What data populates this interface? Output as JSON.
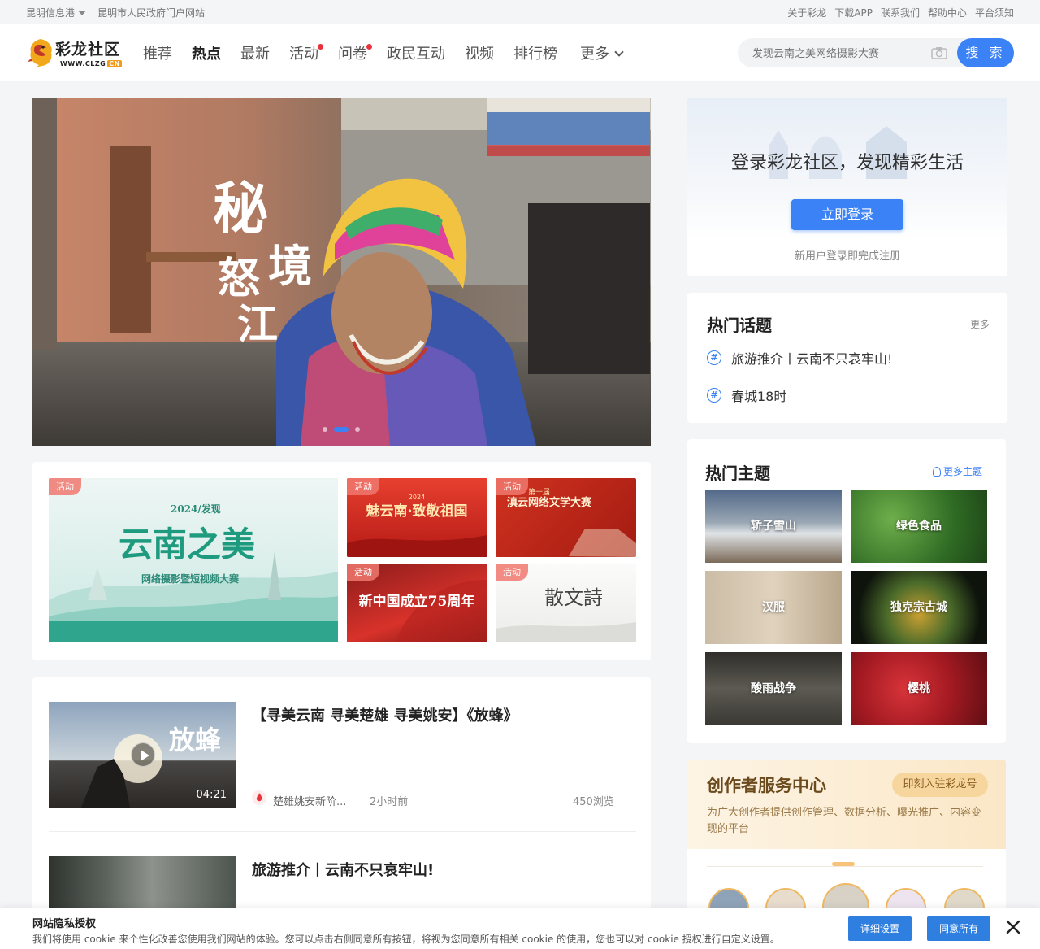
{
  "util_bar": {
    "left": [
      "昆明信息港",
      "昆明市人民政府门户网站"
    ],
    "right": [
      "关于彩龙",
      "下载APP",
      "联系我们",
      "帮助中心",
      "平台须知"
    ]
  },
  "logo": {
    "text": "彩龙社区",
    "url": "WWW.CLZG",
    "badge": "CN"
  },
  "nav": [
    "推荐",
    "热点",
    "最新",
    "活动",
    "问卷",
    "政民互动",
    "视频",
    "排行榜",
    "更多"
  ],
  "nav_active": "热点",
  "search": {
    "placeholder": "发现云南之美网络摄影大赛",
    "button": "搜 索"
  },
  "hero": {
    "calligraphy": [
      "秘",
      "境",
      "怒",
      "江"
    ]
  },
  "banners": [
    {
      "tag": "活动",
      "year_line": "2024/发现",
      "title": "云南之美",
      "subtitle": "网络摄影暨短视频大赛"
    },
    {
      "tag": "活动",
      "title": "魅云南·致敬祖国",
      "year": "2024"
    },
    {
      "tag": "活动",
      "title": "滇云网络文学大赛",
      "sub": "第十届"
    },
    {
      "tag": "活动",
      "title": "新中国成立75周年"
    },
    {
      "tag": "活动",
      "title": "散文詩"
    }
  ],
  "feed": [
    {
      "title": "【寻美云南 寻美楚雄 寻美姚安】《放蜂》",
      "source": "楚雄姚安新阶...",
      "time": "2小时前",
      "views": "450浏览",
      "duration": "04:21",
      "thumb_text": "放蜂"
    },
    {
      "title": "旅游推介丨云南不只哀牢山!"
    }
  ],
  "login": {
    "title": "登录彩龙社区，发现精彩生活",
    "button": "立即登录",
    "sub": "新用户登录即完成注册"
  },
  "hot_topics": {
    "title": "热门话题",
    "more": "更多",
    "items": [
      "旅游推介丨云南不只哀牢山!",
      "春城18时"
    ]
  },
  "hot_themes": {
    "title": "热门主题",
    "more": "更多主题",
    "items": [
      "轿子雪山",
      "绿色食品",
      "汉服",
      "独克宗古城",
      "酸雨战争",
      "樱桃"
    ]
  },
  "creator": {
    "title": "创作者服务中心",
    "join": "即刻入驻彩龙号",
    "desc": "为广大创作者提供创作管理、数据分析、曝光推广、内容变现的平台"
  },
  "cookie": {
    "title": "网站隐私授权",
    "desc": "我们将使用 cookie 来个性化改善您使用我们网站的体验。您可以点击右侧同意所有按钮，将视为您同意所有相关 cookie 的使用，您也可以对 cookie 授权进行自定义设置。",
    "detail_button": "详细设置",
    "agree_button": "同意所有"
  },
  "colors": {
    "accent": "#3b82f6",
    "hot_dot": "#e8323c",
    "creator_gold": "#6b4a1e"
  }
}
